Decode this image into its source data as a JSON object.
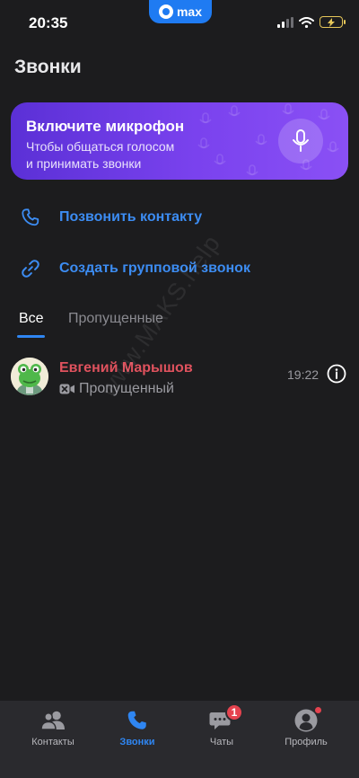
{
  "status_bar": {
    "time": "20:35",
    "app_pill": "max",
    "icons": [
      "cellular-signal-icon",
      "wifi-icon",
      "battery-charging-icon"
    ]
  },
  "page": {
    "title": "Звонки"
  },
  "mic_banner": {
    "title": "Включите микрофон",
    "subtitle_line1": "Чтобы общаться голосом",
    "subtitle_line2": "и принимать звонки",
    "icon": "microphone-icon"
  },
  "actions": [
    {
      "label": "Позвонить контакту",
      "icon": "phone-icon"
    },
    {
      "label": "Создать групповой звонок",
      "icon": "link-icon"
    }
  ],
  "tabs": [
    {
      "label": "Все",
      "selected": true
    },
    {
      "label": "Пропущенные",
      "selected": false
    }
  ],
  "calls": [
    {
      "name": "Евгений Марышов",
      "status": "Пропущенный",
      "status_icon": "missed-video-call-icon",
      "time": "19:22",
      "avatar": "frog-avatar"
    }
  ],
  "watermark": "www.MAKS.help",
  "tab_bar": {
    "items": [
      {
        "label": "Контакты",
        "icon": "contacts-icon",
        "active": false
      },
      {
        "label": "Звонки",
        "icon": "phone-icon",
        "active": true
      },
      {
        "label": "Чаты",
        "icon": "chats-icon",
        "active": false,
        "badge": "1"
      },
      {
        "label": "Профиль",
        "icon": "profile-icon",
        "active": false,
        "dot": true
      }
    ]
  },
  "colors": {
    "background": "#1c1c1e",
    "accent": "#2f86f2",
    "link": "#3c8cf2",
    "missed": "#e0525e",
    "badge": "#e5434f",
    "banner_start": "#5b30d6",
    "banner_end": "#8a50f5"
  }
}
